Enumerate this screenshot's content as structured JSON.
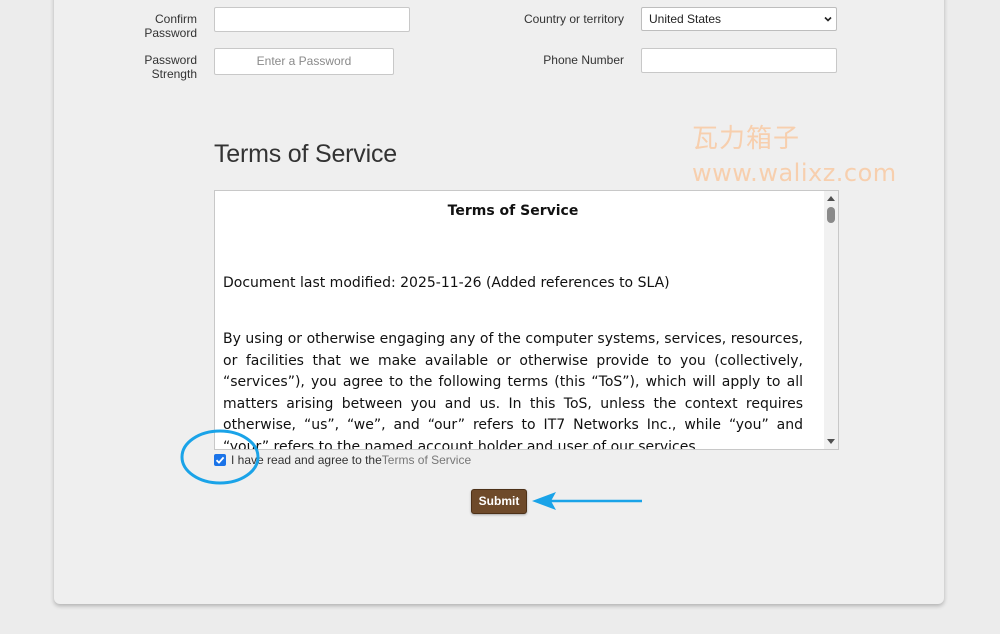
{
  "form": {
    "confirm_password_label": "Confirm Password",
    "confirm_password_value": "",
    "password_strength_label": "Password Strength",
    "password_strength_placeholder": "Enter a Password",
    "country_label": "Country or territory",
    "country_value": "United States",
    "phone_label": "Phone Number",
    "phone_value": ""
  },
  "tos": {
    "heading": "Terms of Service",
    "doc_title": "Terms of Service",
    "last_modified": "Document last modified: 2025-11-26 (Added references to SLA)",
    "paragraph1": "By using or otherwise engaging any of the computer systems, services, resources, or facilities that we make available or otherwise provide to you (collectively, “services”), you agree to the following terms (this “ToS”), which will apply to all matters arising between you and us. In this ToS, unless the context requires otherwise, “us”, “we”, and “our” refers to IT7 Networks Inc., while “you” and “your” refers to the named account holder and user of our services."
  },
  "agreement": {
    "checked": true,
    "text": "I have read and agree to the ",
    "link_text": "Terms of Service"
  },
  "actions": {
    "submit_label": "Submit"
  },
  "watermark": {
    "chinese": "瓦力箱子",
    "url": "www.walixz.com"
  },
  "icons": {
    "select_arrow": "chevron-down-icon",
    "checkbox_check": "check-icon",
    "annotation_circle": "highlight-circle",
    "annotation_arrow": "pointer-arrow"
  },
  "colors": {
    "accent_blue": "#1a73e8",
    "annotation_blue": "#1aa3e8",
    "submit_brown": "#6e4a2a",
    "watermark_orange": "#f7cfae"
  }
}
